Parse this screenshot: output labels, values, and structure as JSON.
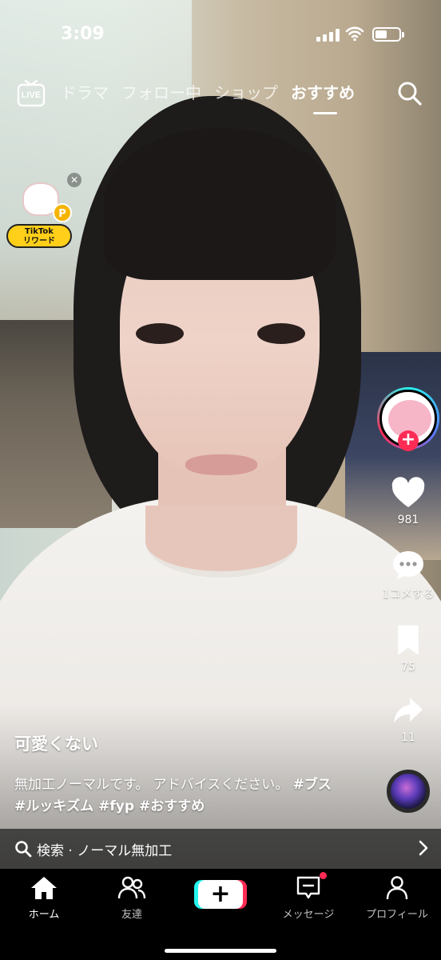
{
  "status_bar": {
    "time": "3:09",
    "battery_level": 0.5
  },
  "top_nav": {
    "live_label": "LIVE",
    "tabs": [
      {
        "label": "ドラマ"
      },
      {
        "label": "フォロー中"
      },
      {
        "label": "ショップ"
      },
      {
        "label": "おすすめ"
      }
    ],
    "active_tab": "おすすめ"
  },
  "rewards_badge": {
    "coin_text": "P",
    "line1": "TikTok",
    "line2": "リワード"
  },
  "right_rail": {
    "like_count": "981",
    "comment_label": "1コメする",
    "bookmark_count": "75",
    "share_count": "11",
    "icons": [
      "profile-avatar",
      "follow-plus-icon",
      "heart-icon",
      "comment-icon",
      "bookmark-icon",
      "share-icon",
      "sound-disc"
    ]
  },
  "caption": {
    "username": "可愛くない",
    "text": "無加工ノーマルです。 アドバイスください。",
    "hashtags": "#ブス #ルッキズム #fyp #おすすめ"
  },
  "search_strip": {
    "text": "検索 · ノーマル無加工"
  },
  "bottom_nav": {
    "items": [
      {
        "label": "ホーム"
      },
      {
        "label": "友達"
      },
      {
        "label": ""
      },
      {
        "label": "メッセージ"
      },
      {
        "label": "プロフィール"
      }
    ]
  },
  "colors": {
    "accent_red": "#fe2c55",
    "accent_cyan": "#25f4ee",
    "nav_bg": "#000000"
  }
}
